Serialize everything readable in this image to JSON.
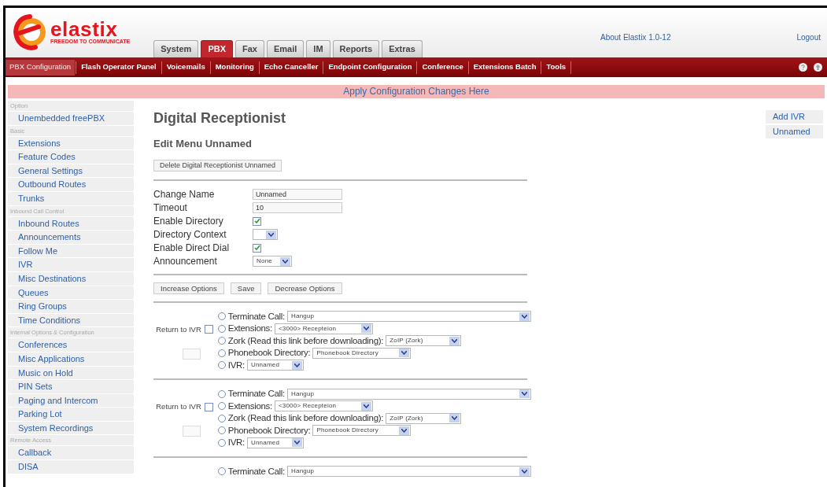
{
  "logo": {
    "name": "elastix",
    "tagline": "FREEDOM TO COMMUNICATE"
  },
  "tabs": [
    {
      "label": "System",
      "selected": false
    },
    {
      "label": "PBX",
      "selected": true
    },
    {
      "label": "Fax",
      "selected": false
    },
    {
      "label": "Email",
      "selected": false
    },
    {
      "label": "IM",
      "selected": false
    },
    {
      "label": "Reports",
      "selected": false
    },
    {
      "label": "Extras",
      "selected": false
    }
  ],
  "header_links": [
    "About Elastix 1.0-12",
    "Logout"
  ],
  "subnav": [
    {
      "label": "PBX Configuration",
      "selected": true
    },
    {
      "label": "Flash Operator Panel",
      "selected": false
    },
    {
      "label": "Voicemails",
      "selected": false
    },
    {
      "label": "Monitoring",
      "selected": false
    },
    {
      "label": "Echo Canceller",
      "selected": false
    },
    {
      "label": "Endpoint Configuration",
      "selected": false
    },
    {
      "label": "Conference",
      "selected": false
    },
    {
      "label": "Extensions Batch",
      "selected": false
    },
    {
      "label": "Tools",
      "selected": false
    }
  ],
  "apply_bar": "Apply Configuration Changes Here",
  "sidebar": [
    {
      "heading": "Option",
      "items": [
        "Unembedded freePBX"
      ]
    },
    {
      "heading": "Basic",
      "items": [
        "Extensions",
        "Feature Codes",
        "General Settings",
        "Outbound Routes",
        "Trunks"
      ]
    },
    {
      "heading": "Inbound Call Control",
      "items": [
        "Inbound Routes",
        "Announcements",
        "Follow Me",
        "IVR",
        "Misc Destinations",
        "Queues",
        "Ring Groups",
        "Time Conditions"
      ]
    },
    {
      "heading": "Internal Options & Configuration",
      "items": [
        "Conferences",
        "Misc Applications",
        "Music on Hold",
        "PIN Sets",
        "Paging and Intercom",
        "Parking Lot",
        "System Recordings"
      ]
    },
    {
      "heading": "Remote Access",
      "items": [
        "Callback",
        "DISA"
      ]
    }
  ],
  "title": "Digital Receptionist",
  "subtitle": "Edit Menu Unnamed",
  "delete_button": "Delete Digital Receptionist Unnamed",
  "form": [
    {
      "kind": "text",
      "label": "Change Name",
      "value": "Unnamed"
    },
    {
      "kind": "text",
      "label": "Timeout",
      "value": "10"
    },
    {
      "kind": "checkbox",
      "label": "Enable Directory",
      "checked": true
    },
    {
      "kind": "select",
      "label": "Directory Context"
    },
    {
      "kind": "checkbox",
      "label": "Enable Direct Dial",
      "checked": true
    },
    {
      "kind": "select",
      "label": "Announcement",
      "value": "None"
    }
  ],
  "action_buttons": [
    "Increase Options",
    "Save",
    "Decrease Options"
  ],
  "options": [
    {
      "return_label": "Return to IVR",
      "return_checked": false,
      "destinations": [
        {
          "kind": "wide",
          "label": "Terminate Call:",
          "value": "Hangup",
          "selected": false
        },
        {
          "kind": "medium",
          "label": "Extensions:",
          "value": "<3000> Recepteion",
          "selected": false
        },
        {
          "kind": "small",
          "label": "Zork (Read this link before downloading):",
          "value": "ZoIP (Zork)",
          "selected": false
        },
        {
          "kind": "medium",
          "label": "Phonebook Directory:",
          "value": "Phonebook Directory",
          "selected": false
        },
        {
          "kind": "tiny",
          "label": "IVR:",
          "value": "Unnamed",
          "selected": false
        }
      ]
    },
    {
      "return_label": "Return to IVR",
      "return_checked": false,
      "destinations": [
        {
          "kind": "wide",
          "label": "Terminate Call:",
          "value": "Hangup",
          "selected": false
        },
        {
          "kind": "medium",
          "label": "Extensions:",
          "value": "<3000> Recepteion",
          "selected": false
        },
        {
          "kind": "small",
          "label": "Zork (Read this link before downloading):",
          "value": "ZoIP (Zork)",
          "selected": false
        },
        {
          "kind": "medium",
          "label": "Phonebook Directory:",
          "value": "Phonebook Directory",
          "selected": false
        },
        {
          "kind": "tiny",
          "label": "IVR:",
          "value": "Unnamed",
          "selected": false
        }
      ]
    },
    {
      "destinations": [
        {
          "kind": "wide",
          "label": "Terminate Call:",
          "value": "Hangup",
          "selected": false
        }
      ]
    }
  ],
  "right_menu": [
    "Add IVR",
    "Unnamed"
  ]
}
